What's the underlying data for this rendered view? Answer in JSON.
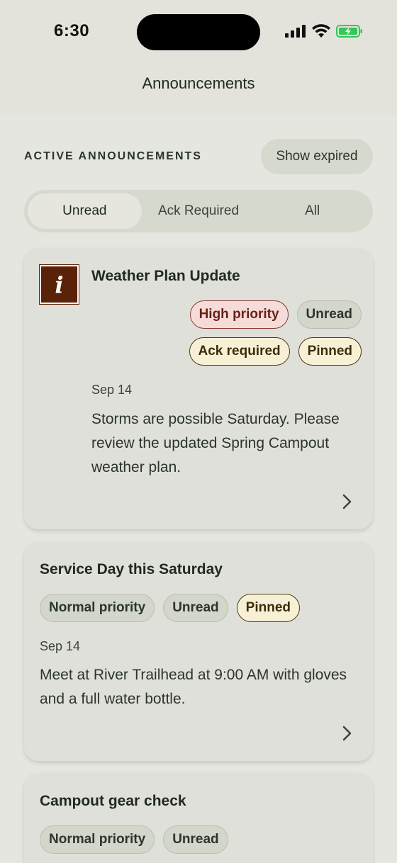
{
  "status": {
    "time": "6:30"
  },
  "header": {
    "title": "Announcements"
  },
  "section": {
    "label": "ACTIVE ANNOUNCEMENTS",
    "show_expired": "Show expired"
  },
  "tabs": [
    {
      "label": "Unread",
      "active": true
    },
    {
      "label": "Ack Required",
      "active": false
    },
    {
      "label": "All",
      "active": false
    }
  ],
  "announcements": [
    {
      "title": "Weather Plan Update",
      "icon": "info-icon",
      "badges": [
        "High priority",
        "Unread",
        "Ack required",
        "Pinned"
      ],
      "date": "Sep 14",
      "body": "Storms are possible Saturday. Please review the updated Spring Campout weather plan."
    },
    {
      "title": "Service Day this Saturday",
      "badges": [
        "Normal priority",
        "Unread",
        "Pinned"
      ],
      "date": "Sep 14",
      "body": "Meet at River Trailhead at 9:00 AM with gloves and a full water bottle."
    },
    {
      "title": "Campout gear check",
      "badges": [
        "Normal priority",
        "Unread"
      ]
    }
  ],
  "colors": {
    "high_priority": "#6a1f18",
    "info_icon_bg": "#5a2208",
    "pinned_bg": "#f8f0d6"
  }
}
